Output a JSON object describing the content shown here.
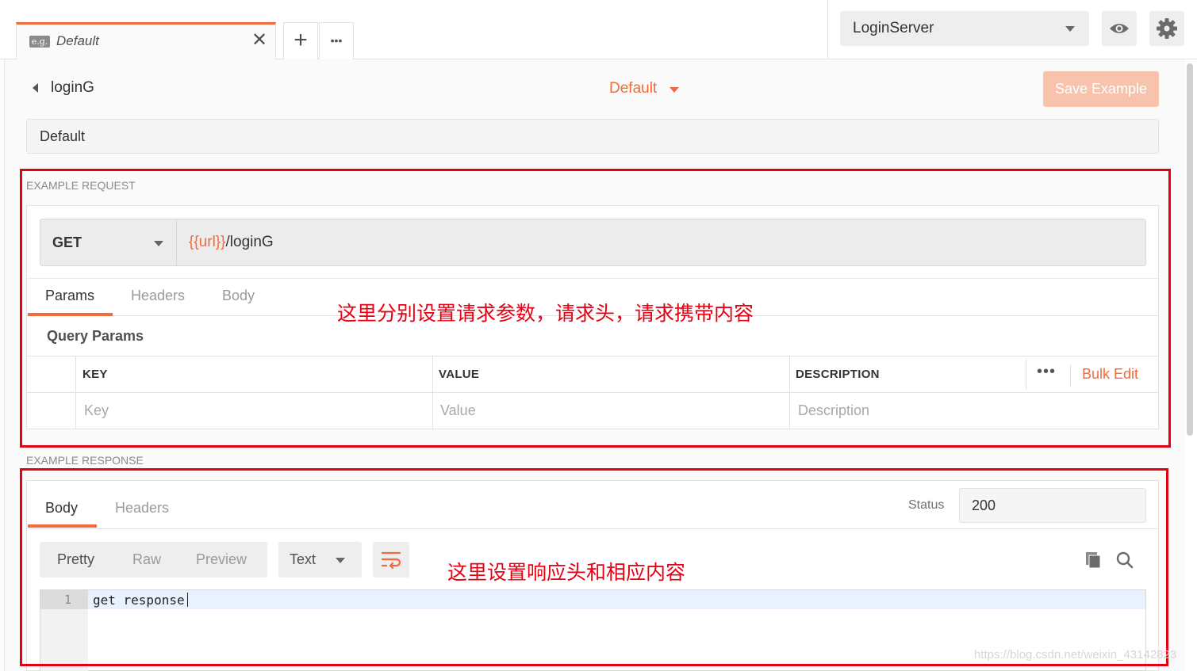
{
  "top_tab": {
    "badge": "e.g.",
    "title": "Default",
    "close": "✕"
  },
  "top_actions": {
    "add": "+",
    "more": "•••"
  },
  "environment": {
    "selected": "LoginServer"
  },
  "header": {
    "back_label": "loginG",
    "example_name": "Default",
    "save_label": "Save Example"
  },
  "example_name_field": {
    "value": "Default"
  },
  "request": {
    "section_label": "EXAMPLE REQUEST",
    "method": "GET",
    "url_var": "{{url}}",
    "url_path": "/loginG",
    "tabs": [
      "Params",
      "Headers",
      "Body"
    ],
    "active_tab": "Params",
    "query_params_label": "Query Params",
    "table": {
      "headers": [
        "KEY",
        "VALUE",
        "DESCRIPTION"
      ],
      "placeholders": [
        "Key",
        "Value",
        "Description"
      ],
      "more": "•••",
      "bulk_edit": "Bulk Edit"
    }
  },
  "response": {
    "section_label": "EXAMPLE RESPONSE",
    "tabs": [
      "Body",
      "Headers"
    ],
    "active_tab": "Body",
    "status_label": "Status",
    "status_value": "200",
    "formats": [
      "Pretty",
      "Raw",
      "Preview"
    ],
    "active_format": "Pretty",
    "content_type": "Text",
    "editor": {
      "line_numbers": [
        "1"
      ],
      "lines": [
        "get response"
      ]
    }
  },
  "annotations": {
    "request_note": "这里分别设置请求参数，请求头，请求携带内容",
    "response_note": "这里设置响应头和相应内容"
  },
  "watermark": "https://blog.csdn.net/weixin_43142823",
  "colors": {
    "accent": "#f26b3a",
    "annotation": "#e60012",
    "save_disabled": "#f8c3ad"
  }
}
